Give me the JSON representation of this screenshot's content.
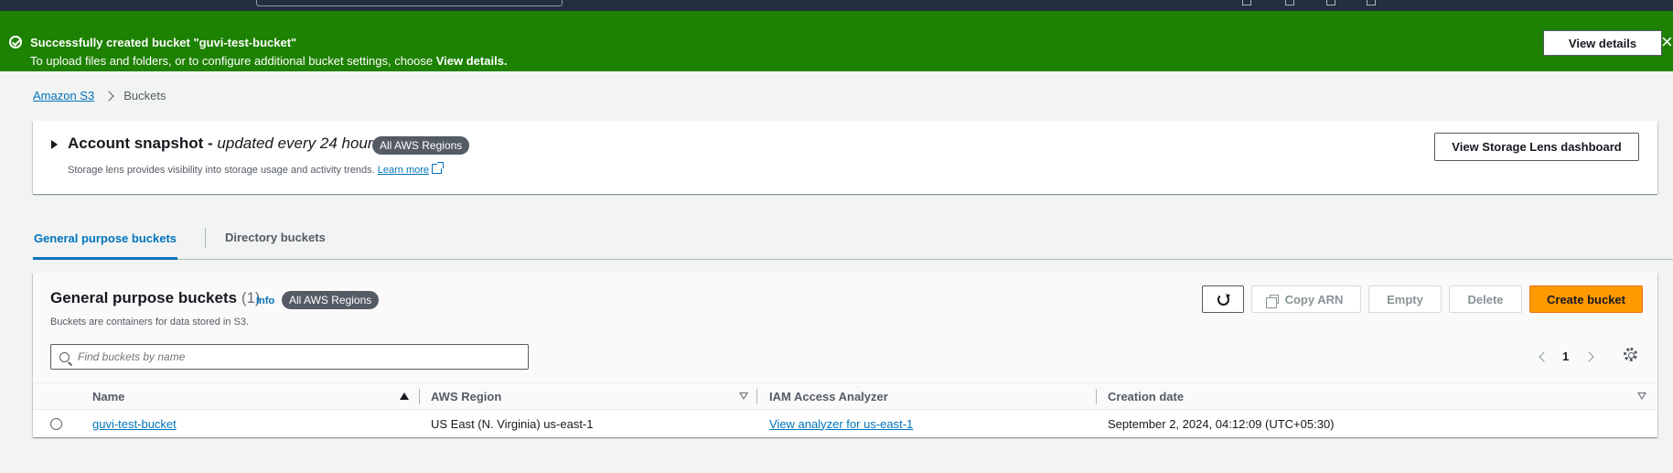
{
  "flash": {
    "title": "Successfully created bucket \"guvi-test-bucket\"",
    "desc_prefix": "To upload files and folders, or to configure additional bucket settings, choose ",
    "desc_bold": "View details.",
    "view_details": "View details",
    "close": "×",
    "color": "#1d8102"
  },
  "breadcrumb": {
    "root": "Amazon S3",
    "current": "Buckets"
  },
  "snapshot": {
    "title": "Account snapshot - ",
    "title_italic": "updated every 24 hours",
    "badge": "All AWS Regions",
    "subtitle": "Storage lens provides visibility into storage usage and activity trends.",
    "learn_more": "Learn more",
    "lens_button": "View Storage Lens dashboard"
  },
  "tabs": [
    {
      "label": "General purpose buckets",
      "active": true
    },
    {
      "label": "Directory buckets",
      "active": false
    }
  ],
  "panel": {
    "title": "General purpose buckets",
    "count": "(1)",
    "info": "Info",
    "badge": "All AWS Regions",
    "desc": "Buckets are containers for data stored in S3.",
    "copy_arn": "Copy ARN",
    "empty": "Empty",
    "delete": "Delete",
    "create": "Create bucket",
    "search_placeholder": "Find buckets by name",
    "page": "1",
    "accent": "#ff9900"
  },
  "table": {
    "columns": [
      "Name",
      "AWS Region",
      "IAM Access Analyzer",
      "Creation date"
    ],
    "rows": [
      {
        "name": "guvi-test-bucket",
        "region": "US East (N. Virginia) us-east-1",
        "analyzer": "View analyzer for us-east-1",
        "created": "September 2, 2024, 04:12:09 (UTC+05:30)"
      }
    ]
  }
}
